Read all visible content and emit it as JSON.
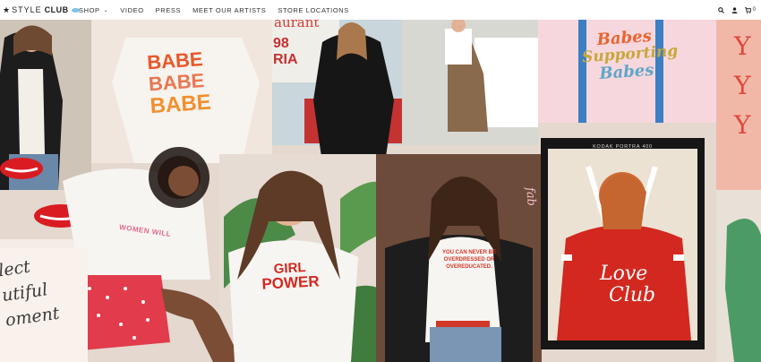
{
  "brand": {
    "star": "★",
    "name": "STYLE",
    "name_bold": "CLUB"
  },
  "nav": {
    "items": [
      {
        "label": "SHOP",
        "has_dropdown": true
      },
      {
        "label": "VIDEO"
      },
      {
        "label": "PRESS"
      },
      {
        "label": "MEET OUR ARTISTS"
      },
      {
        "label": "STORE LOCATIONS"
      }
    ],
    "dropdown_glyph": "⌄"
  },
  "header_icons": {
    "search": "search-icon",
    "account": "user-icon",
    "cart": "cart-icon",
    "cart_count": "0"
  },
  "collage": {
    "polaroid_caption": "KODAK PORTRA 400",
    "shirt_texts": {
      "babe": [
        "BABE",
        "BABE",
        "BABE"
      ],
      "babes_supporting": [
        "Babes",
        "Supporting",
        "Babes"
      ],
      "women_will": "WOMEN WILL",
      "girl_power": [
        "GIRL",
        "POWER"
      ],
      "overdressed": [
        "YOU CAN NEVER BE",
        "OVERDRESSED OR",
        "OVEREDUCATED."
      ],
      "love_club": [
        "Love",
        "Club"
      ],
      "sign_partial": [
        "98",
        "RIA"
      ],
      "sign_top": "aurant",
      "letters_right": [
        "Y",
        "Y",
        "Y"
      ],
      "handwritten": [
        "lect",
        "utiful",
        "oment"
      ],
      "side_fab": "fab"
    },
    "colors": {
      "red_jacket": "#d3281f",
      "pink_bg": "#f2c9c2",
      "orange_text": "#e8572a",
      "dark": "#1b1b1b"
    }
  }
}
